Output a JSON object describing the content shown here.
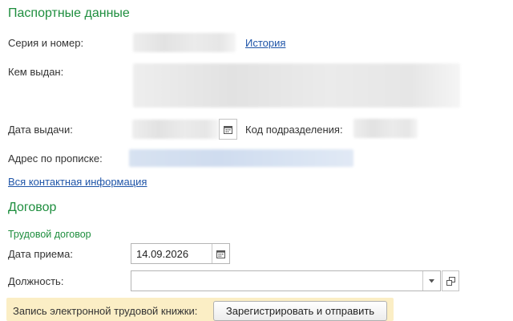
{
  "passport": {
    "title": "Паспортные данные",
    "series_label": "Серия и номер:",
    "history_link": "История",
    "issued_by_label": "Кем выдан:",
    "issue_date_label": "Дата выдачи:",
    "department_code_label": "Код подразделения:",
    "address_label": "Адрес по прописке:",
    "contact_link": "Вся контактная информация"
  },
  "contract": {
    "title": "Договор",
    "subtitle": "Трудовой договор",
    "hire_date_label": "Дата приема:",
    "hire_date_value": "14.09.2026",
    "position_label": "Должность:",
    "position_value": ""
  },
  "banner": {
    "label": "Запись электронной трудовой книжки:",
    "button_label": "Зарегистрировать и отправить"
  },
  "colors": {
    "section_title": "#1e8e3e",
    "link": "#1f55a8",
    "banner_bg": "#fbeec5"
  }
}
